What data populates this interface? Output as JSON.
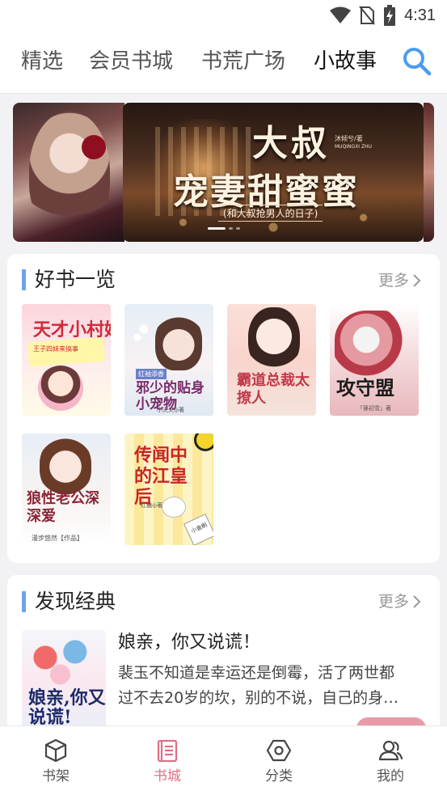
{
  "status_bar": {
    "time": "4:31"
  },
  "top_tabs": [
    {
      "label": "精选",
      "active": false
    },
    {
      "label": "会员书城",
      "active": false
    },
    {
      "label": "书荒广场",
      "active": false
    },
    {
      "label": "小故事",
      "active": true
    }
  ],
  "banner": {
    "title_line1": "大叔",
    "title_line2": "宠妻甜蜜蜜",
    "author": "沐倾兮/著",
    "author_pinyin": "MUQINGXI ZHU",
    "subtitle": "(和大叔抢男人的日子)",
    "slide_count": 3,
    "active_slide": 1
  },
  "good_books": {
    "title": "好书一览",
    "more_label": "更多",
    "covers": [
      {
        "title": "天才小村姑",
        "tagline": "王子四妹来搞事"
      },
      {
        "title": "邪少的贴身小宠物",
        "badge": "红袖添香",
        "author": "小夫夫◎著"
      },
      {
        "title": "霸道总裁太撩人"
      },
      {
        "title": "攻守盟",
        "author": "「篠初雪」著"
      },
      {
        "title": "狼性老公深深爱",
        "author": "漫步悠然【作品】"
      },
      {
        "title": "传闻中的江皇后",
        "author": "红糖◎著",
        "sticker": "小金刷"
      }
    ]
  },
  "classics": {
    "title": "发现经典",
    "more_label": "更多",
    "book": {
      "title": "娘亲，你又说谎！",
      "desc_line1": "裴玉不知道是幸运还是倒霉，活了两世都",
      "desc_line2": "过不去20岁的坎，别的不说，自己的身…",
      "cover_title": "娘亲,你又说谎!"
    }
  },
  "bottom_nav": [
    {
      "label": "书架",
      "icon": "cube-icon",
      "active": false
    },
    {
      "label": "书城",
      "icon": "book-list-icon",
      "active": true
    },
    {
      "label": "分类",
      "icon": "hexagon-icon",
      "active": false
    },
    {
      "label": "我的",
      "icon": "users-icon",
      "active": false
    }
  ],
  "colors": {
    "accent": "#e26e86",
    "section_bar": "#6fa4e8",
    "search_icon": "#4a9cf0"
  }
}
